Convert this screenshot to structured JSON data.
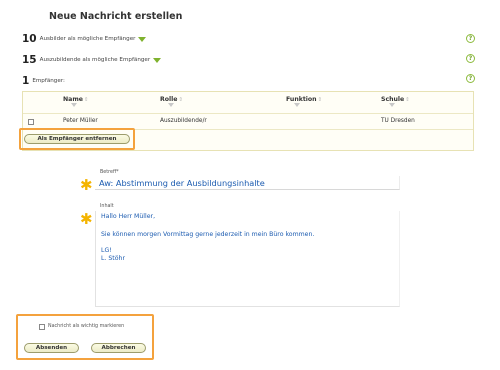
{
  "page_title": "Neue Nachricht erstellen",
  "groups": [
    {
      "count": "10",
      "label": "Ausbilder als mögliche Empfänger"
    },
    {
      "count": "15",
      "label": "Auszubildende als mögliche Empfänger"
    }
  ],
  "help_icon_text": "?",
  "recipients": {
    "count": "1",
    "label": "Empfänger:",
    "columns": [
      {
        "label": "Name",
        "sort": "⇕"
      },
      {
        "label": "Rolle",
        "sort": "⇕"
      },
      {
        "label": "Funktion",
        "sort": "⇕"
      },
      {
        "label": "Schule",
        "sort": "⇕"
      }
    ],
    "rows": [
      {
        "name": "Peter Müller",
        "role": "Auszubildende/r",
        "function": "",
        "school": "TU Dresden"
      }
    ],
    "remove_button": "Als Empfänger entfernen"
  },
  "message": {
    "required_mark": "✱",
    "subject_label": "Betreff*",
    "subject_value": "Aw: Abstimmung der Ausbildungsinhalte",
    "body_label": "Inhalt",
    "body_lines": [
      "Hallo Herr Müller,",
      "Sie können morgen Vormittag gerne jederzeit in mein Büro kommen.",
      "LG!",
      "L. Stöhr"
    ]
  },
  "footer": {
    "checkbox_label": "Nachricht als wichtig markieren",
    "send_button": "Absenden",
    "cancel_button": "Abbrechen"
  },
  "colors": {
    "accent_green": "#7fb22e",
    "highlight_orange": "#f4a23d",
    "required_star": "#f4b400",
    "text_blue": "#1b5bb0"
  }
}
